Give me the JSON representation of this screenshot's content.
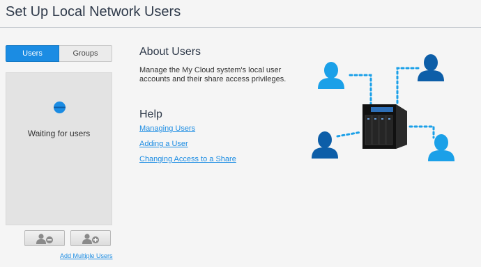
{
  "header": {
    "title": "Set Up Local Network Users"
  },
  "tabs": [
    {
      "label": "Users",
      "active": true
    },
    {
      "label": "Groups",
      "active": false
    }
  ],
  "user_list": {
    "status_text": "Waiting for users"
  },
  "actions": {
    "remove_user_icon": "user-minus-icon",
    "add_user_icon": "user-plus-icon",
    "add_multiple_label": "Add Multiple Users"
  },
  "about": {
    "heading": "About Users",
    "text": "Manage the My Cloud system's local user accounts and their share access privileges."
  },
  "help": {
    "heading": "Help",
    "links": [
      {
        "label": "Managing Users"
      },
      {
        "label": "Adding a User"
      },
      {
        "label": "Changing Access to a Share"
      }
    ]
  },
  "colors": {
    "accent": "#1b8ce3",
    "user_light": "#1ba0e8",
    "user_dark": "#0d5ea8",
    "device": "#1a1a1a"
  }
}
